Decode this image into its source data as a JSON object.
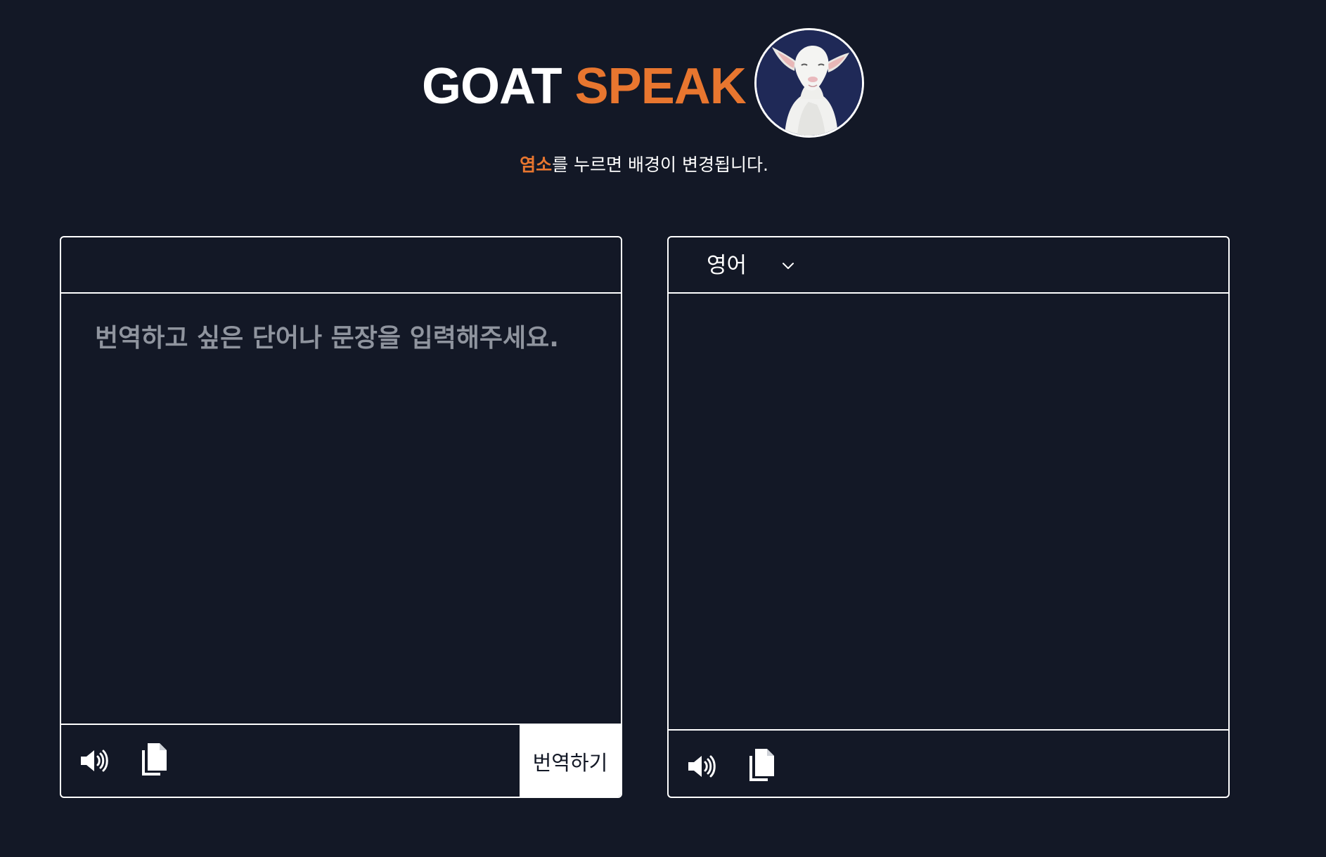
{
  "header": {
    "title_part1": "GOAT",
    "title_part2": "SPEAK",
    "avatar_alt": "goat",
    "subtitle_highlight": "염소",
    "subtitle_rest": "를 누르면 배경이 변경됩니다."
  },
  "source_panel": {
    "placeholder": "번역하고 싶은 단어나 문장을 입력해주세요.",
    "value": "",
    "speak_icon": "speaker-icon",
    "copy_icon": "copy-icon",
    "translate_label": "번역하기"
  },
  "target_panel": {
    "language": "영어",
    "result": "",
    "speak_icon": "speaker-icon",
    "copy_icon": "copy-icon"
  },
  "colors": {
    "background": "#131826",
    "accent": "#e8762f",
    "border": "#ffffff",
    "placeholder": "#8f949e"
  }
}
